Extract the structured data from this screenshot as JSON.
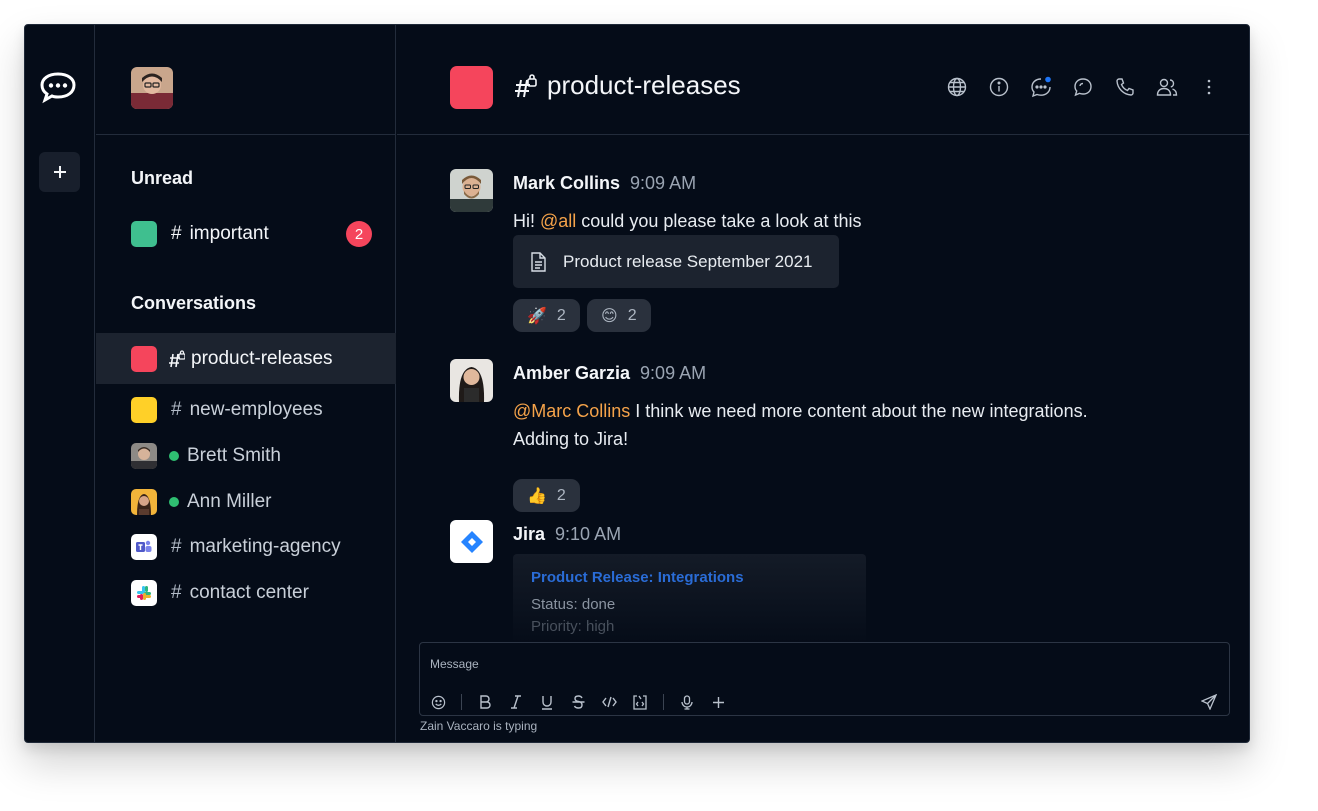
{
  "rail": {
    "logo_icon": "rocketchat-logo-icon",
    "add_label": "+"
  },
  "sidebar": {
    "user_avatar": "user-avatar",
    "unread_title": "Unread",
    "unread_items": [
      {
        "hash": "#",
        "label": "important",
        "color": "#3fbf8f",
        "badge": "2"
      }
    ],
    "conversations_title": "Conversations",
    "conversations": [
      {
        "type": "private-channel",
        "label": "product-releases",
        "color": "#f5455c",
        "active": true
      },
      {
        "type": "channel",
        "hash": "#",
        "label": "new-employees",
        "color": "#ffd028"
      },
      {
        "type": "dm",
        "label": "Brett Smith",
        "status": "online"
      },
      {
        "type": "dm",
        "label": "Ann Miller",
        "status": "online"
      },
      {
        "type": "channel",
        "hash": "#",
        "label": "marketing-agency",
        "app": "teams"
      },
      {
        "type": "channel",
        "hash": "#",
        "label": "contact center",
        "app": "slack"
      }
    ]
  },
  "header": {
    "room_color": "#f5455c",
    "room_title": "product-releases",
    "icons": [
      "globe-icon",
      "info-icon",
      "threads-icon",
      "discussion-icon",
      "phone-icon",
      "members-icon",
      "kebab-menu-icon"
    ]
  },
  "messages": [
    {
      "author": "Mark Collins",
      "time": "9:09 AM",
      "text_pre": "Hi! ",
      "mention": "@all",
      "text_post": " could you please take a look at this",
      "attachment": "Product release September 2021",
      "reactions": [
        {
          "emoji": "🚀",
          "count": "2"
        },
        {
          "emoji": "😊",
          "count": "2"
        }
      ]
    },
    {
      "author": "Amber Garzia",
      "time": "9:09 AM",
      "mention": "@Marc Collins",
      "text_post": " I think we need more content about the new integrations.",
      "line2": "Adding to Jira!",
      "reactions": [
        {
          "emoji": "👍",
          "count": "2"
        }
      ]
    },
    {
      "author": "Jira",
      "time": "9:10 AM",
      "card": {
        "title": "Product Release: Integrations",
        "status": "Status: done",
        "priority": "Priority: high"
      }
    }
  ],
  "composer": {
    "placeholder": "Message",
    "tools": [
      "emoji-icon",
      "bold-icon",
      "italic-icon",
      "underline-icon",
      "strikethrough-icon",
      "code-icon",
      "code-block-icon",
      "microphone-icon",
      "plus-icon"
    ],
    "send_icon": "send-icon",
    "typing": "Zain Vaccaro is typing"
  }
}
